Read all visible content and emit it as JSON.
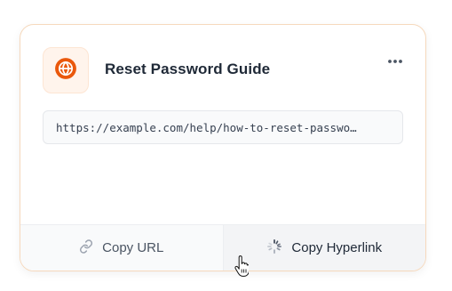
{
  "card": {
    "title": "Reset Password Guide",
    "app_icon": "globe-icon",
    "menu_icon": "more-horizontal-icon",
    "url": "https://example.com/help/how-to-reset-password",
    "url_display": "https://example.com/help/how-to-reset-passwo…"
  },
  "actions": {
    "copy_url": {
      "label": "Copy URL",
      "icon": "link-icon"
    },
    "copy_hyperlink": {
      "label": "Copy Hyperlink",
      "icon": "loader-icon"
    }
  },
  "colors": {
    "accent": "#ea580c",
    "card_border": "#f6d9bd",
    "icon_bg": "#fff4ec"
  }
}
